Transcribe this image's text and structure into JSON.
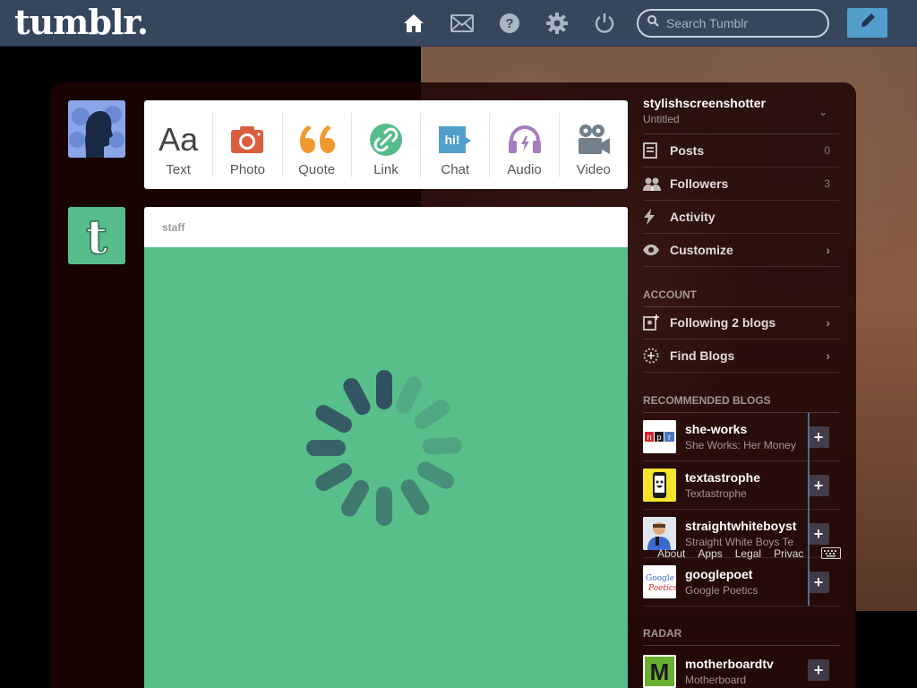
{
  "app": {
    "logo": "tumblr."
  },
  "nav": {
    "icons": [
      "home-icon",
      "mail-icon",
      "help-icon",
      "gear-icon",
      "power-icon"
    ],
    "search_placeholder": "Search Tumblr",
    "compose_icon": "pencil-icon"
  },
  "post_types": [
    {
      "label": "Text",
      "glyph": "Aa",
      "color": "#444444"
    },
    {
      "label": "Photo",
      "color": "#d95e40"
    },
    {
      "label": "Quote",
      "glyph": "“",
      "color": "#f2992e"
    },
    {
      "label": "Link",
      "color": "#56bc8a"
    },
    {
      "label": "Chat",
      "glyph": "hi!",
      "color": "#529ecc"
    },
    {
      "label": "Audio",
      "color": "#a77dc2"
    },
    {
      "label": "Video",
      "color": "#748089"
    }
  ],
  "post": {
    "author": "staff"
  },
  "sidebar": {
    "blog_name": "stylishscreenshotter",
    "blog_title": "Untitled",
    "items": [
      {
        "label": "Posts",
        "count": "0"
      },
      {
        "label": "Followers",
        "count": "3"
      },
      {
        "label": "Activity"
      },
      {
        "label": "Customize"
      }
    ],
    "account_heading": "ACCOUNT",
    "account_items": [
      {
        "label": "Following 2 blogs"
      },
      {
        "label": "Find Blogs"
      }
    ],
    "recommended_heading": "RECOMMENDED BLOGS",
    "recommended": [
      {
        "name": "she-works",
        "desc": "She Works: Her Money"
      },
      {
        "name": "textastrophe",
        "desc": "Textastrophe"
      },
      {
        "name": "straightwhiteboyst",
        "desc": "Straight White Boys Te"
      },
      {
        "name": "googlepoet",
        "desc": "Google Poetics"
      }
    ],
    "footer": [
      "About",
      "Apps",
      "Legal",
      "Privac"
    ],
    "radar_heading": "RADAR",
    "radar": {
      "name": "motherboardtv",
      "desc": "Motherboard"
    }
  },
  "colors": {
    "topbar": "#36465d",
    "accent": "#529ecc",
    "post_body": "#58be8a"
  }
}
